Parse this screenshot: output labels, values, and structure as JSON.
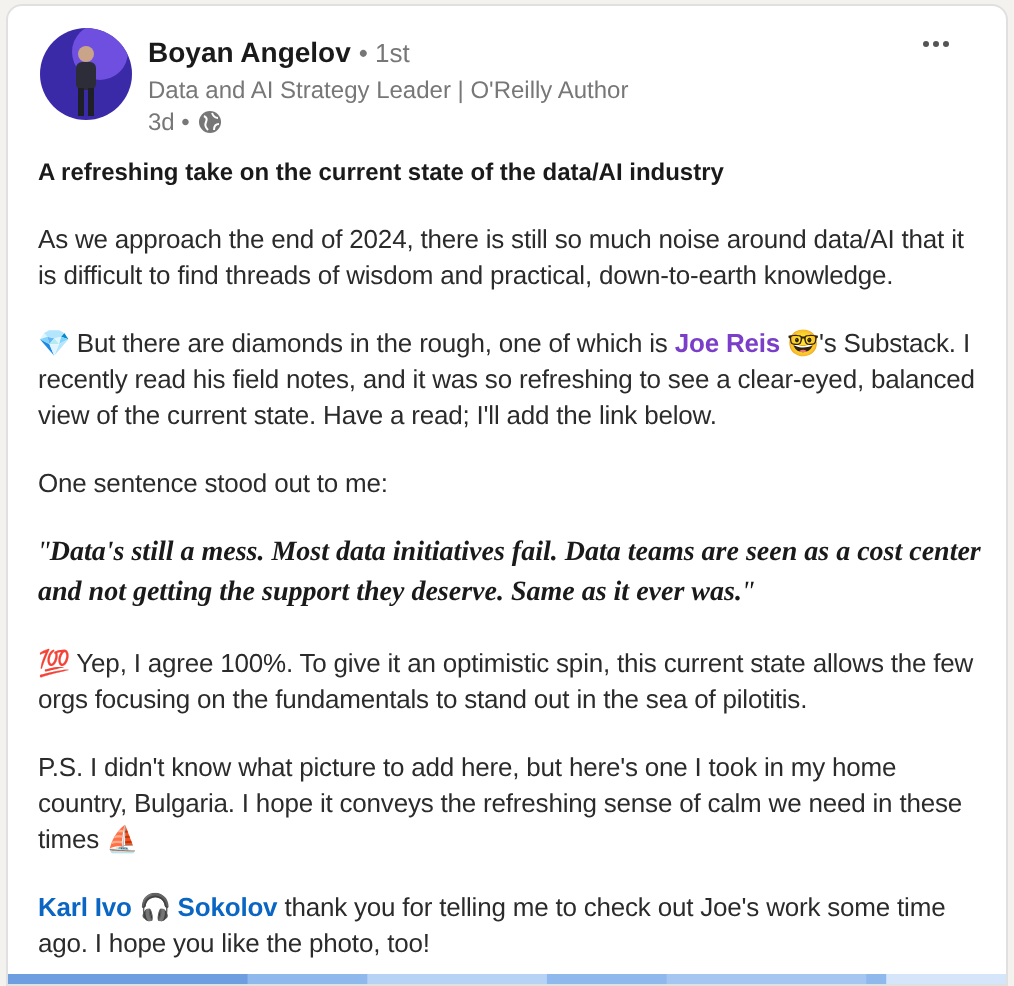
{
  "author": {
    "name": "Boyan Angelov",
    "degree": "• 1st",
    "headline": "Data and AI Strategy Leader | O'Reilly Author",
    "time": "3d •"
  },
  "title": "A refreshing take on the current state of the data/AI industry",
  "paragraphs": [
    {
      "kind": "text",
      "segments": [
        {
          "kind": "plain",
          "text": "As we approach the end of 2024, there is still so much noise around data/AI that it is difficult to find threads of wisdom and practical, down-to-earth knowledge."
        }
      ]
    },
    {
      "kind": "text",
      "segments": [
        {
          "kind": "plain",
          "text": "💎 But there are diamonds in the rough, one of which is "
        },
        {
          "kind": "mention",
          "text": "Joe Reis",
          "color": "#7a3ec8"
        },
        {
          "kind": "plain",
          "text": " 🤓's Substack. I recently read his field notes, and it was so refreshing to see a clear-eyed, balanced view of the current state. Have a read; I'll add the link below."
        }
      ]
    },
    {
      "kind": "text",
      "segments": [
        {
          "kind": "plain",
          "text": "One sentence stood out to me:"
        }
      ]
    },
    {
      "kind": "quote",
      "segments": [
        {
          "kind": "plain",
          "text": "\"**Data's still a mess. Most data initiatives fail. Data teams are seen as a cost center and not getting the support they deserve. Same as it ever was.**\""
        }
      ]
    },
    {
      "kind": "text",
      "segments": [
        {
          "kind": "plain",
          "text": "💯 Yep, I agree 100%. To give it an optimistic spin, this current state allows the few orgs focusing on the fundamentals to stand out in the sea of pilotitis."
        }
      ]
    },
    {
      "kind": "text",
      "segments": [
        {
          "kind": "plain",
          "text": "P.S. I didn't know what picture to add here, but here's one I took in my home country, Bulgaria. I hope it conveys the refreshing sense of calm we need in these times ⛵"
        }
      ]
    },
    {
      "kind": "text",
      "segments": [
        {
          "kind": "mention",
          "text": "Karl Ivo 🎧 Sokolov",
          "color": "#0a66c2"
        },
        {
          "kind": "plain",
          "text": " thank you for telling me to check out Joe's work some time ago. I hope you like the photo, too!"
        }
      ]
    }
  ]
}
